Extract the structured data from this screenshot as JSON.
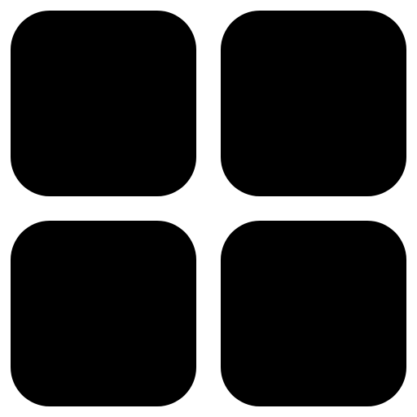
{
  "icon": {
    "name": "grid-icon",
    "color": "#000000",
    "background": "#ffffff",
    "tiles": [
      "top-left",
      "top-right",
      "bottom-left",
      "bottom-right"
    ]
  }
}
